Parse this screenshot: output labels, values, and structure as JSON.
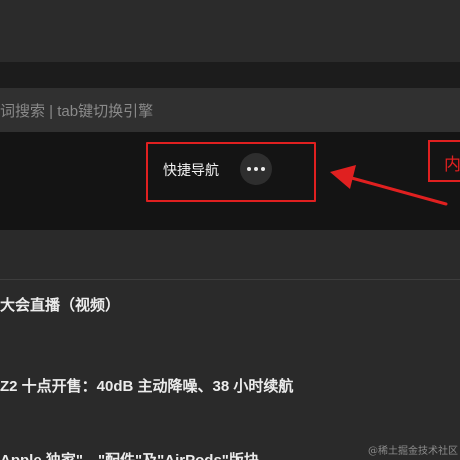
{
  "search": {
    "placeholder": "词搜索 | tab键切换引擎"
  },
  "quick_nav": {
    "label": "快捷导航",
    "more_icon": "more-horizontal-icon"
  },
  "annotation": {
    "callout_text": "内",
    "color": "#e02020"
  },
  "news": {
    "items": [
      "大会直播（视频）",
      "Z2 十点开售：40dB 主动降噪、38 小时续航",
      "Apple 独家\"、\"配件\"及\"AirPods\"版块"
    ]
  },
  "watermark": "@稀土掘金技术社区"
}
